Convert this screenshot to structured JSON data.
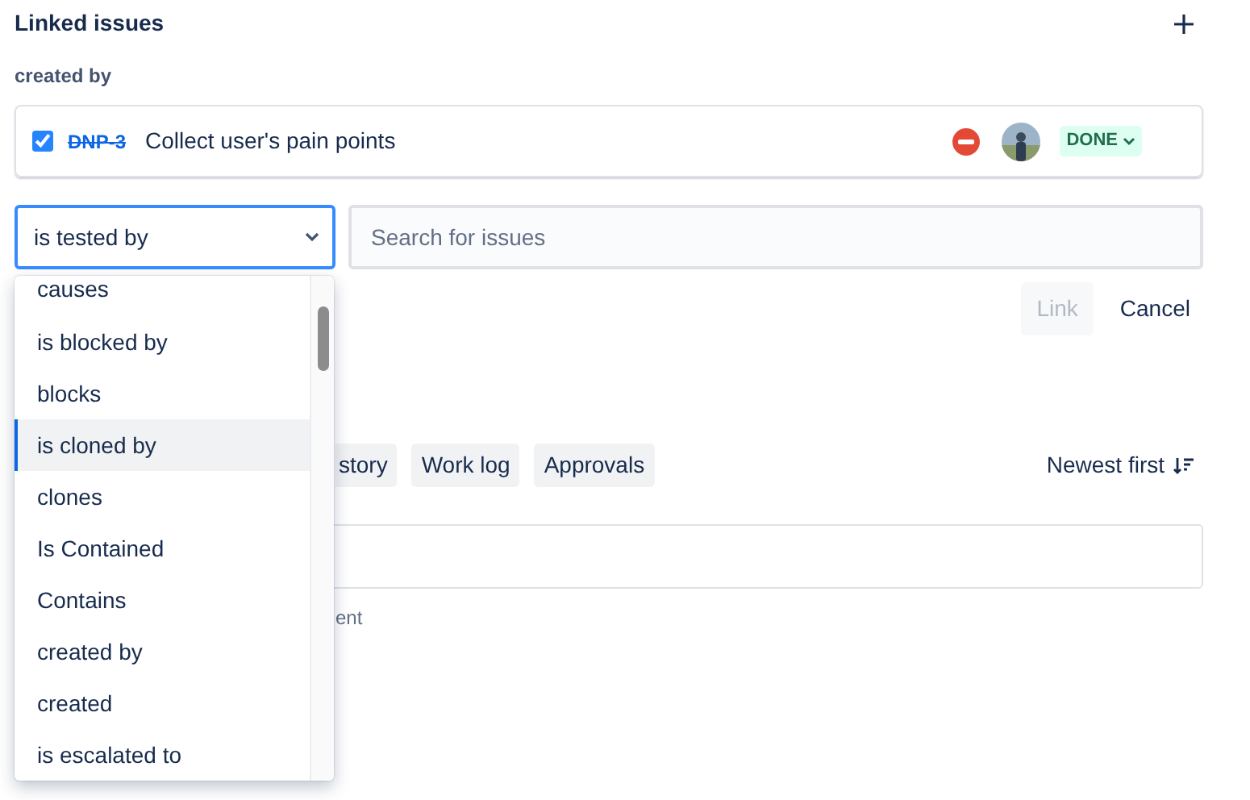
{
  "section": {
    "title": "Linked issues"
  },
  "groups": [
    {
      "label": "created by",
      "issues": [
        {
          "checked": true,
          "key": "DNP-3",
          "resolved": true,
          "summary": "Collect user's pain points",
          "status": "DONE"
        }
      ]
    }
  ],
  "link_form": {
    "link_type": "is tested by",
    "search": {
      "placeholder": "Search for issues"
    },
    "buttons": [
      {
        "label": "Link",
        "disabled": true
      },
      {
        "label": "Cancel",
        "disabled": false
      }
    ]
  },
  "dropdown": {
    "options": [
      {
        "label": "causes",
        "selected": false
      },
      {
        "label": "is blocked by",
        "selected": false
      },
      {
        "label": "blocks",
        "selected": false
      },
      {
        "label": "is cloned by",
        "selected": true
      },
      {
        "label": "clones",
        "selected": false
      },
      {
        "label": "Is Contained",
        "selected": false
      },
      {
        "label": "Contains",
        "selected": false
      },
      {
        "label": "created by",
        "selected": false
      },
      {
        "label": "created",
        "selected": false
      },
      {
        "label": "is escalated to",
        "selected": false
      }
    ]
  },
  "activity": {
    "tabs": [
      {
        "label": "story"
      },
      {
        "label": "Work log"
      },
      {
        "label": "Approvals"
      }
    ],
    "sort": "Newest first",
    "comment_hint": "ent"
  }
}
